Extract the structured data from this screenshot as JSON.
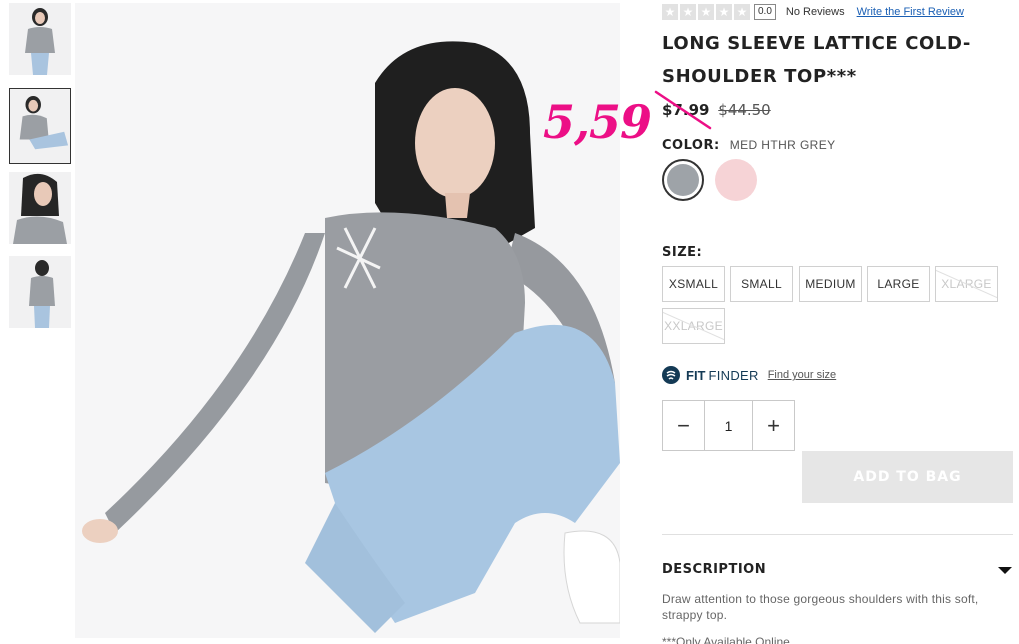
{
  "rating": {
    "score": "0.0",
    "reviews": "No Reviews",
    "write_link": "Write the First Review"
  },
  "product": {
    "title": "LONG SLEEVE LATTICE COLD-SHOULDER TOP***"
  },
  "price": {
    "sale": "$7.99",
    "original": "$44.50",
    "handwritten": "5,59"
  },
  "color": {
    "label": "COLOR:",
    "value": "MED HTHR GREY",
    "swatches": [
      "#9ea3a8",
      "#f6d3d6"
    ]
  },
  "size": {
    "label": "SIZE:",
    "options": [
      {
        "label": "XSMALL",
        "available": true
      },
      {
        "label": "SMALL",
        "available": true
      },
      {
        "label": "MEDIUM",
        "available": true
      },
      {
        "label": "LARGE",
        "available": true
      },
      {
        "label": "XLARGE",
        "available": false
      },
      {
        "label": "XXLARGE",
        "available": false
      }
    ]
  },
  "fit_finder": {
    "strong": "FIT",
    "light": "FINDER",
    "link": "Find your size"
  },
  "quantity": {
    "minus": "−",
    "value": "1",
    "plus": "+"
  },
  "cart": {
    "add_label": "ADD TO BAG"
  },
  "description": {
    "heading": "DESCRIPTION",
    "text": "Draw attention to those gorgeous shoulders with this soft, strappy top.",
    "note": "***Only Available Online"
  },
  "colors": {
    "accent": "#143a55",
    "handwriting": "#ec0f86",
    "disabled_button": "#e6e6e6"
  },
  "icons": {
    "rating": "star-icon",
    "fit": "fit-finder-icon",
    "expand": "caret-down-icon"
  }
}
